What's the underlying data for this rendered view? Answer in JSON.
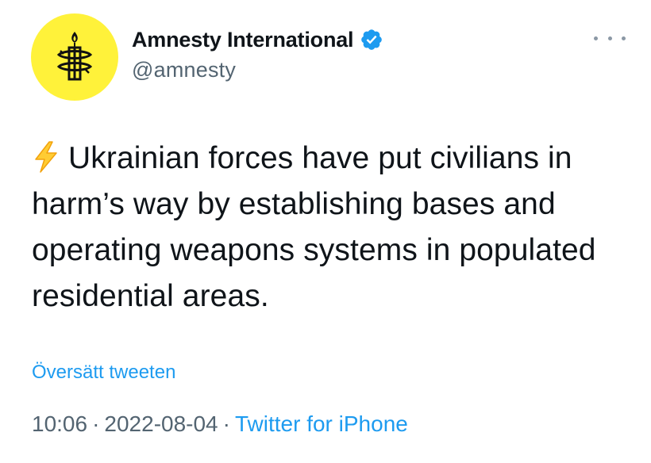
{
  "author": {
    "display_name": "Amnesty International",
    "handle": "@amnesty",
    "verified": true,
    "avatar_bg": "#fff23a"
  },
  "tweet": {
    "icon": "high-voltage-emoji-icon",
    "text": "Ukrainian forces have put civilians in harm’s way by establishing bases and operating weapons systems in populated residential areas."
  },
  "translate_label": "Översätt tweeten",
  "meta": {
    "time": "10:06",
    "separator": "·",
    "date": "2022-08-04",
    "source": "Twitter for iPhone"
  },
  "colors": {
    "text": "#0f1419",
    "secondary": "#536471",
    "link": "#1d9bf0",
    "verified_badge": "#1d9bf0"
  },
  "icons": [
    "amnesty-candle-logo-icon",
    "verified-badge-icon",
    "more-options-icon",
    "high-voltage-emoji-icon"
  ]
}
